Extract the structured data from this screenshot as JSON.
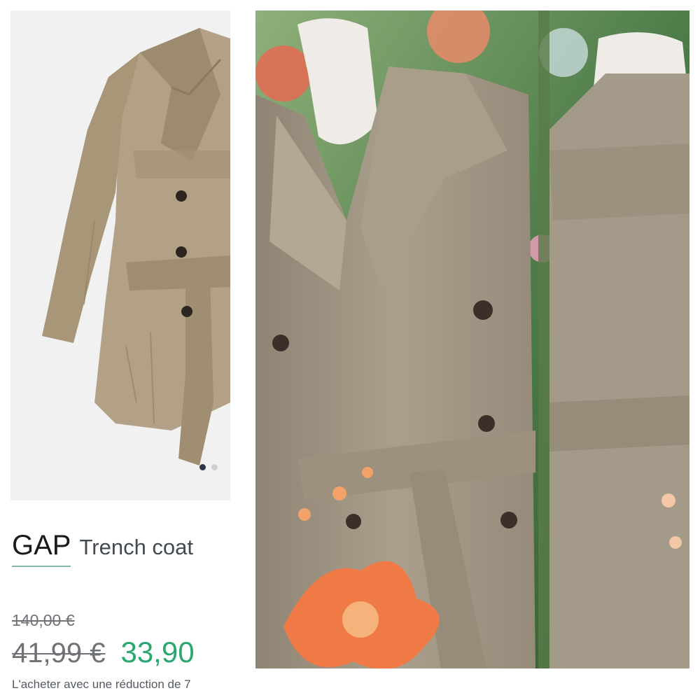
{
  "listing": {
    "brand": "GAP",
    "product_type": "Trench coat",
    "price_original": "140,00 €",
    "price_old": "41,99 €",
    "price_current": "33,90",
    "discount_text": "L'acheter avec une réduction de 7",
    "carousel": {
      "pages": 2,
      "current": 1
    }
  },
  "colors": {
    "price_green": "#2aa86f",
    "coat_beige": "#a8957a",
    "dot_active": "#2b3648"
  },
  "icons": [
    "carousel-dot-icon"
  ]
}
